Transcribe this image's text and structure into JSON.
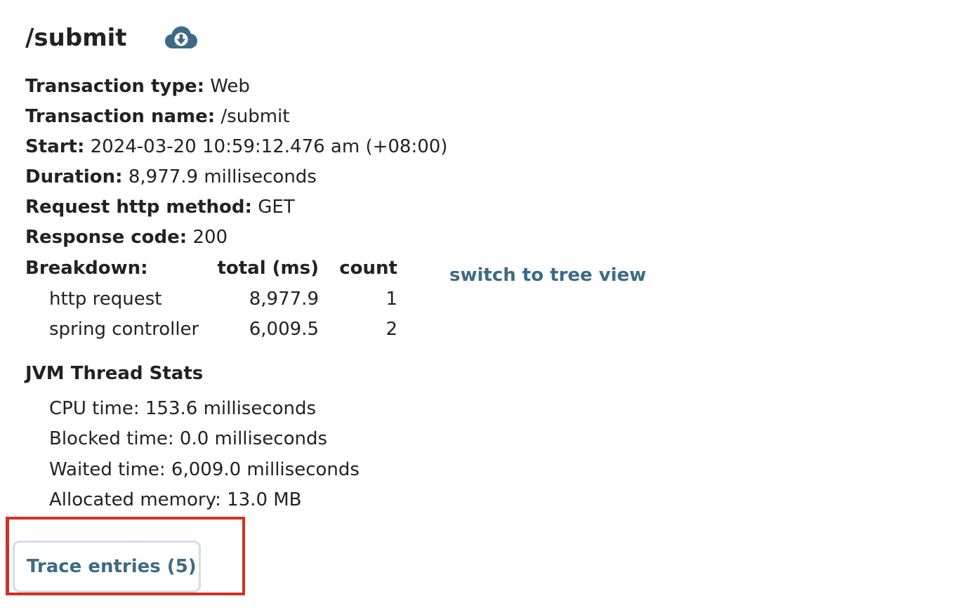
{
  "header": {
    "title": "/submit",
    "download_icon": "cloud-download-icon",
    "accent_color": "#3d6b86"
  },
  "details": [
    {
      "label": "Transaction type:",
      "value": "Web"
    },
    {
      "label": "Transaction name:",
      "value": "/submit"
    },
    {
      "label": "Start:",
      "value": "2024-03-20 10:59:12.476 am (+08:00)"
    },
    {
      "label": "Duration:",
      "value": "8,977.9 milliseconds"
    },
    {
      "label": "Request http method:",
      "value": "GET"
    },
    {
      "label": "Response code:",
      "value": "200"
    }
  ],
  "breakdown": {
    "label": "Breakdown:",
    "columns": [
      "total (ms)",
      "count"
    ],
    "rows": [
      {
        "name": "http request",
        "total": "8,977.9",
        "count": "1"
      },
      {
        "name": "spring controller",
        "total": "6,009.5",
        "count": "2"
      }
    ],
    "switch_link": "switch to tree view"
  },
  "jvm": {
    "heading": "JVM Thread Stats",
    "items": [
      "CPU time: 153.6 milliseconds",
      "Blocked time: 0.0 milliseconds",
      "Waited time: 6,009.0 milliseconds",
      "Allocated memory: 13.0 MB"
    ]
  },
  "trace": {
    "button_label": "Trace entries (5)",
    "highlight_color": "#d03224"
  }
}
